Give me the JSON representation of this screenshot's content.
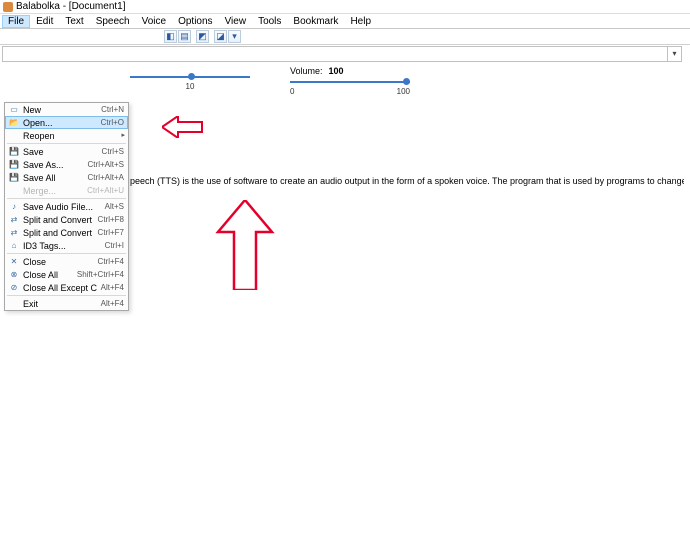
{
  "titlebar": {
    "title": "Balabolka - [Document1]"
  },
  "menubar": {
    "items": [
      "File",
      "Edit",
      "Text",
      "Speech",
      "Voice",
      "Options",
      "View",
      "Tools",
      "Bookmark",
      "Help"
    ]
  },
  "sliders": {
    "pitch": {
      "label": "",
      "min": "",
      "mid": "10",
      "max": ""
    },
    "volume": {
      "label": "Volume:",
      "value": "100",
      "min": "0",
      "max": "100"
    }
  },
  "mainText": "peech (TTS) is the use of software to create an audio output in the form of a spoken voice. The program that is used by programs to change text on the page to an audio output of the spoken voice is normally a text to speech engine.",
  "fileMenu": {
    "items": [
      {
        "icon": "new-file-icon",
        "glyph": "▭",
        "label": "New",
        "shortcut": "Ctrl+N"
      },
      {
        "icon": "open-file-icon",
        "glyph": "📂",
        "label": "Open...",
        "shortcut": "Ctrl+O",
        "selected": true
      },
      {
        "icon": "reopen-icon",
        "glyph": "",
        "label": "Reopen",
        "shortcut": "",
        "submenu": true
      },
      {
        "sep": true
      },
      {
        "icon": "save-icon",
        "glyph": "💾",
        "label": "Save",
        "shortcut": "Ctrl+S"
      },
      {
        "icon": "save-as-icon",
        "glyph": "💾",
        "label": "Save As...",
        "shortcut": "Ctrl+Alt+S"
      },
      {
        "icon": "save-all-icon",
        "glyph": "💾",
        "label": "Save All",
        "shortcut": "Ctrl+Alt+A"
      },
      {
        "icon": "merge-icon",
        "glyph": "",
        "label": "Merge...",
        "shortcut": "Ctrl+Alt+U",
        "disabled": true
      },
      {
        "sep": true
      },
      {
        "icon": "audio-file-icon",
        "glyph": "♪",
        "label": "Save Audio File...",
        "shortcut": "Alt+S"
      },
      {
        "icon": "convert-icon",
        "glyph": "⇄",
        "label": "Split and Convert to Audio Files...",
        "shortcut": "Ctrl+F8"
      },
      {
        "icon": "convert2-icon",
        "glyph": "⇄",
        "label": "Split and Convert (Not Show Window)",
        "shortcut": "Ctrl+F7"
      },
      {
        "icon": "id3-icon",
        "glyph": "⌂",
        "label": "ID3 Tags...",
        "shortcut": "Ctrl+I"
      },
      {
        "sep": true
      },
      {
        "icon": "close-file-icon",
        "glyph": "✕",
        "label": "Close",
        "shortcut": "Ctrl+F4"
      },
      {
        "icon": "close-all-icon",
        "glyph": "⊗",
        "label": "Close All",
        "shortcut": "Shift+Ctrl+F4"
      },
      {
        "icon": "close-except-icon",
        "glyph": "⊘",
        "label": "Close All Except Current",
        "shortcut": "Alt+F4"
      },
      {
        "sep": true
      },
      {
        "icon": "exit-icon",
        "glyph": "",
        "label": "Exit",
        "shortcut": "Alt+F4"
      }
    ]
  }
}
